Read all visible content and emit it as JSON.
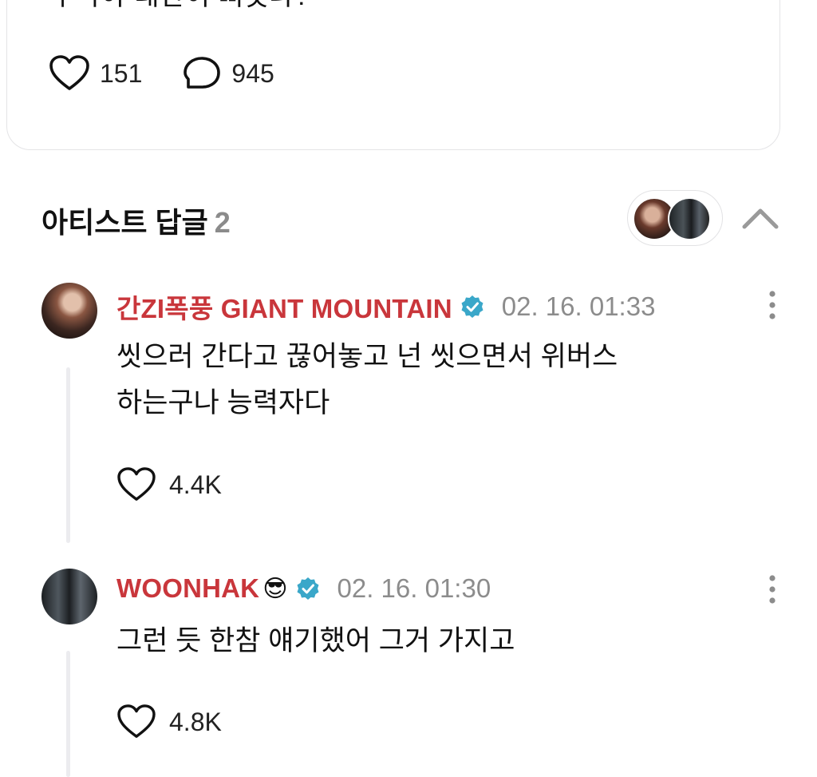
{
  "post": {
    "text": "우낙아 태산이 삐졋냐?",
    "likes": "151",
    "comments": "945",
    "like_icon": "heart-outline-icon",
    "comment_icon": "speech-bubble-outline-icon"
  },
  "artist_replies": {
    "title": "아티스트 답글",
    "count": "2",
    "toggle_icon": "chevron-up-icon"
  },
  "comments": [
    {
      "name": "간ZI폭풍 GIANT MOUNTAIN",
      "emoji": "",
      "verified": true,
      "time": "02. 16. 01:33",
      "text": "씻으러 간다고 끊어놓고 넌 씻으면서 위버스\n하는구나 능력자다",
      "likes": "4.4K"
    },
    {
      "name": "WOONHAK",
      "emoji": "😎",
      "verified": true,
      "time": "02. 16. 01:30",
      "text": "그런 듯 한참 얘기했어 그거 가지고",
      "likes": "4.8K"
    }
  ],
  "colors": {
    "author_name": "#c9363b",
    "verified_badge": "#3aa7c9",
    "muted_text": "#8c8c8c",
    "border": "#e4e4e6"
  }
}
